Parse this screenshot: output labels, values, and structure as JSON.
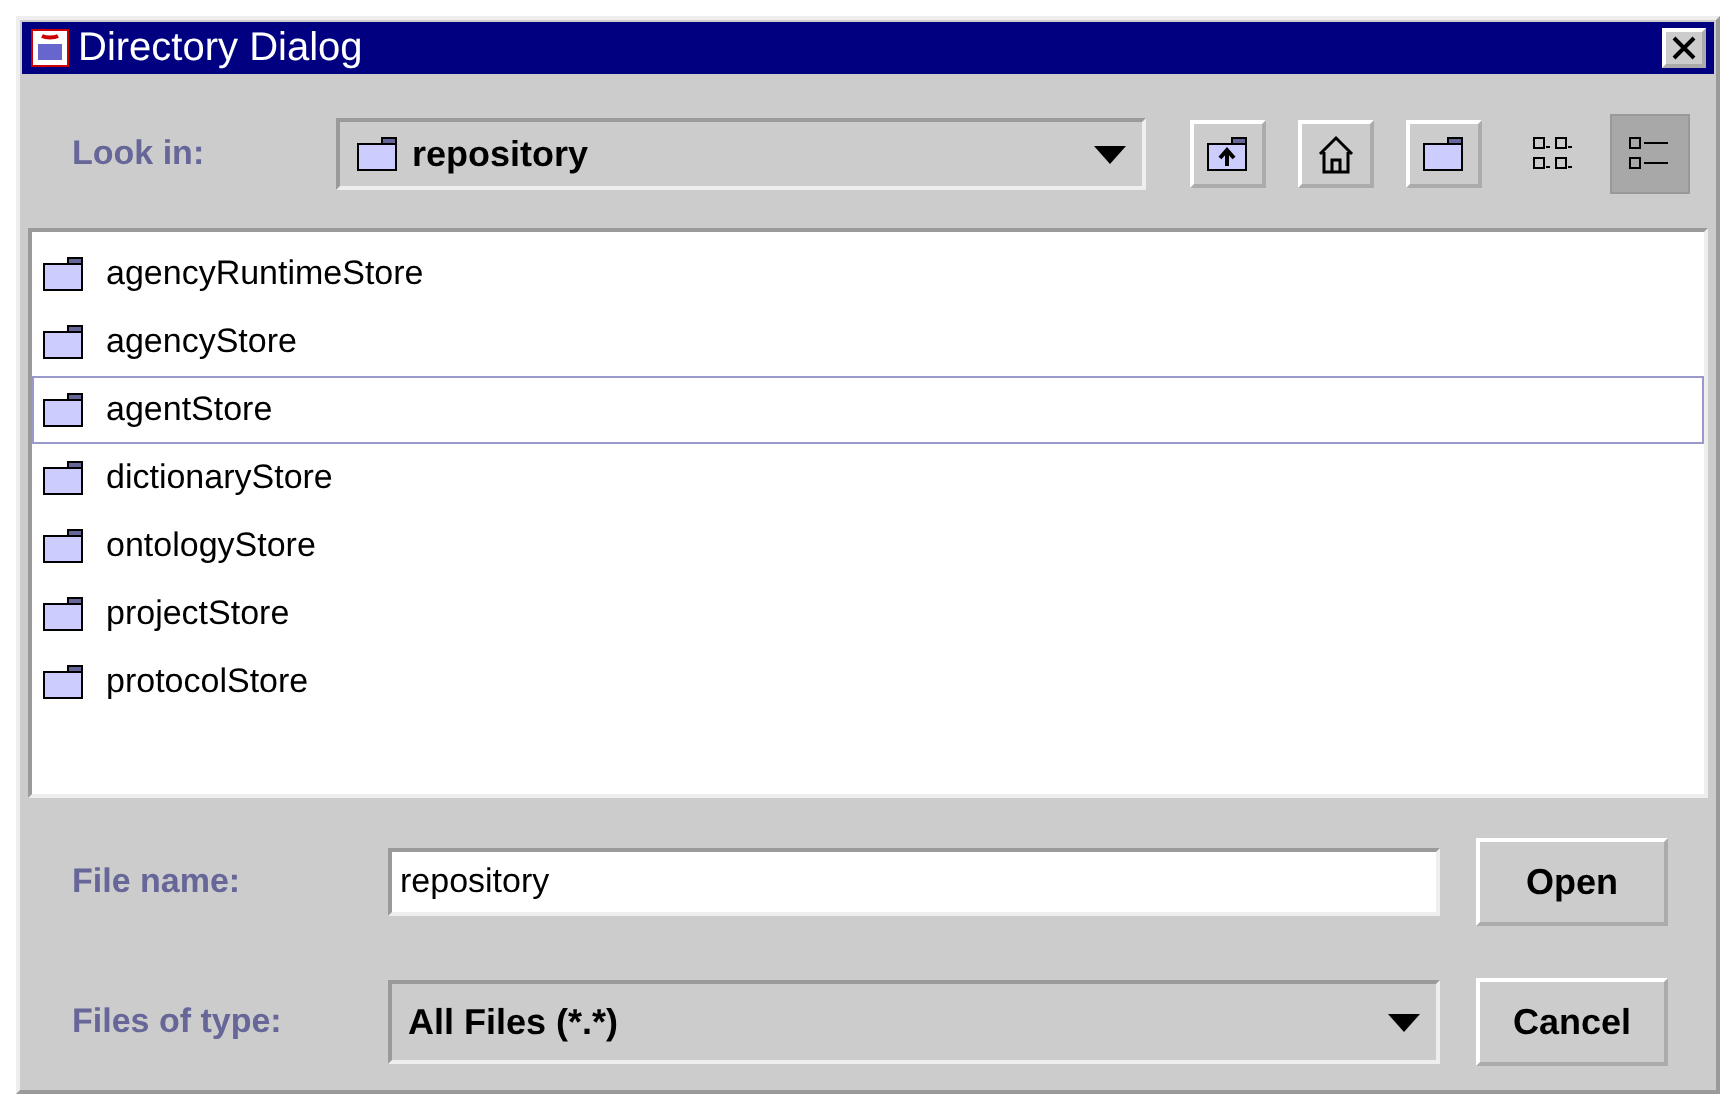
{
  "window": {
    "title": "Directory Dialog"
  },
  "look_in": {
    "label": "Look in:",
    "value": "repository"
  },
  "toolbar": [
    {
      "kind": "up"
    },
    {
      "kind": "home"
    },
    {
      "kind": "new-folder"
    }
  ],
  "view_buttons": [
    {
      "kind": "list",
      "selected": false
    },
    {
      "kind": "details",
      "selected": true
    }
  ],
  "files": [
    {
      "name": "agencyRuntimeStore",
      "focused": false
    },
    {
      "name": "agencyStore",
      "focused": false
    },
    {
      "name": "agentStore",
      "focused": true
    },
    {
      "name": "dictionaryStore",
      "focused": false
    },
    {
      "name": "ontologyStore",
      "focused": false
    },
    {
      "name": "projectStore",
      "focused": false
    },
    {
      "name": "protocolStore",
      "focused": false
    }
  ],
  "file_name": {
    "label": "File name:",
    "value": "repository"
  },
  "file_type": {
    "label": "Files of type:",
    "value": "All Files (*.*)"
  },
  "buttons": [
    "Open",
    "Cancel"
  ]
}
